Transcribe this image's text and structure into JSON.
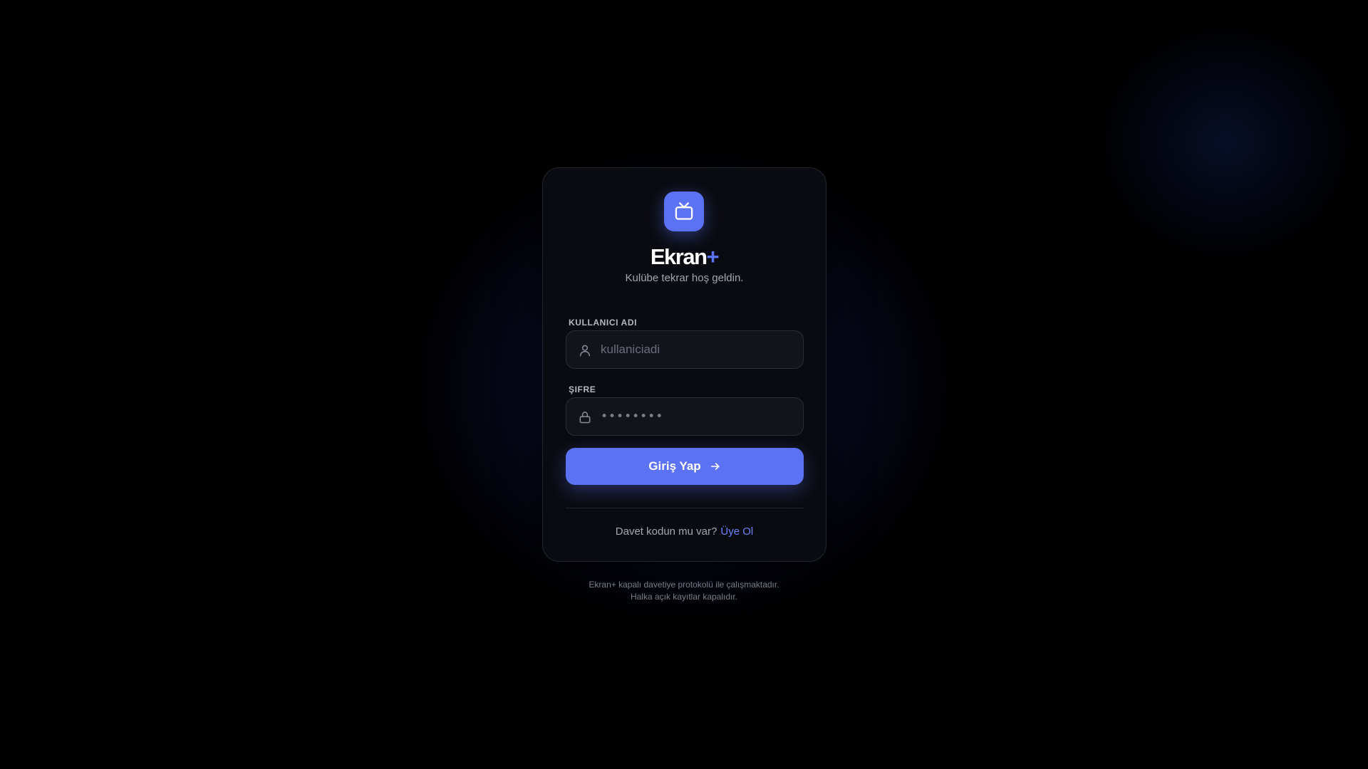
{
  "brand": {
    "name": "Ekran",
    "plus": "+",
    "subtitle": "Kulübe tekrar hoş geldin.",
    "accent": "#5b72f5"
  },
  "logo": {
    "icon": "tv-icon"
  },
  "form": {
    "username": {
      "label": "KULLANICI ADI",
      "placeholder": "kullaniciadi",
      "icon": "user-icon"
    },
    "password": {
      "label": "ŞIFRE",
      "placeholder": "••••••••",
      "icon": "lock-icon"
    },
    "submit": {
      "label": "Giriş Yap",
      "icon": "arrow-right-icon"
    }
  },
  "invite": {
    "text": "Davet kodun mu var?",
    "link": "Üye Ol",
    "link_color": "#6c82ff"
  },
  "footer": {
    "line1": "Ekran+ kapalı davetiye protokolü ile çalışmaktadır.",
    "line2": "Halka açık kayıtlar kapalıdır."
  }
}
